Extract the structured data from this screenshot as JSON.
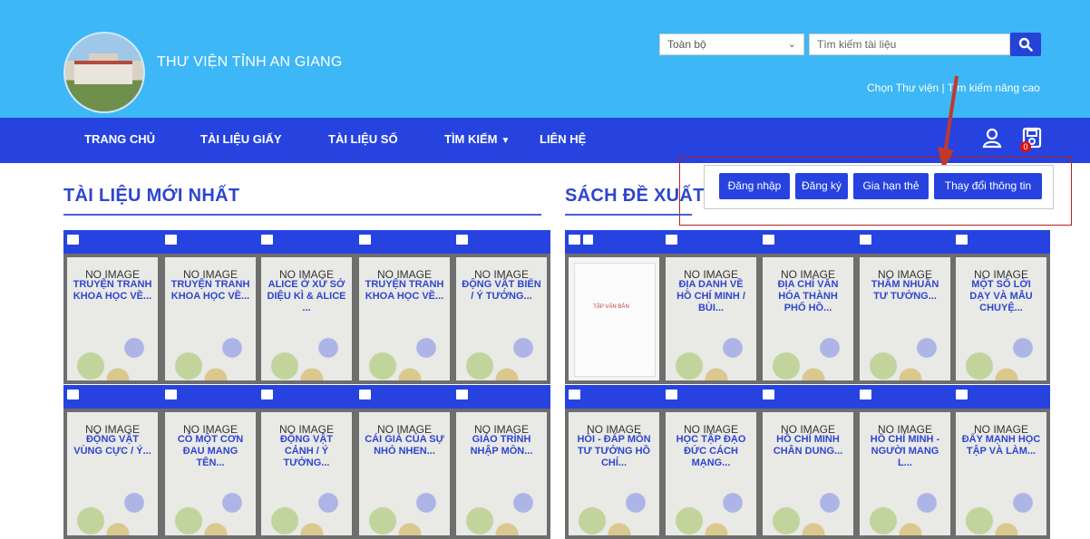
{
  "header": {
    "brand": "THƯ VIỆN TỈNH AN GIANG",
    "scope_value": "Toàn bộ",
    "search_placeholder": "Tìm kiếm tài liệu",
    "links": "Chọn Thư viện | Tìm kiếm nâng cao"
  },
  "nav": {
    "items": [
      {
        "label": "TRANG CHỦ"
      },
      {
        "label": "TÀI LIỆU GIẤY"
      },
      {
        "label": "TÀI LIỆU SỐ"
      },
      {
        "label": "TÌM KIẾM"
      },
      {
        "label": "LIÊN HỆ"
      }
    ],
    "cart_count": "0"
  },
  "user_menu": [
    "Đăng nhập",
    "Đăng ký",
    "Gia hạn thẻ",
    "Thay đổi thông tin"
  ],
  "sections": {
    "latest": "TÀI LIỆU MỚI NHẤT",
    "suggested": "SÁCH ĐỀ XUẤT"
  },
  "no_image": "NO IMAGE",
  "latest_books": [
    "TRUYỆN TRANH KHOA HỌC VỀ...",
    "TRUYỆN TRANH KHOA HỌC VỀ...",
    "ALICE Ở XỨ SỞ DIỆU KÌ & ALICE ...",
    "TRUYỆN TRANH KHOA HỌC VỀ...",
    "ĐỘNG VẬT BIỂN / Ý TƯỞNG...",
    "ĐỘNG VẬT VÙNG CỰC / Ý...",
    "CÓ MỘT CƠN ĐAU MANG TÊN...",
    "ĐỘNG VẬT CẢNH / Ý TƯỞNG...",
    "CÁI GIÁ CỦA SỰ NHỎ NHEN...",
    "GIÁO TRÌNH NHẬP MÔN..."
  ],
  "suggested_books": [
    "",
    "ĐỊA DANH VỀ HỒ CHÍ MINH / BÙI...",
    "ĐỊA CHÍ VĂN HÓA THÀNH PHỐ HỒ...",
    "THẤM NHUẦN TƯ TƯỞNG...",
    "MỘT SỐ LỜI DẠY VÀ MẪU CHUYỆ...",
    "HỎI - ĐÁP MÔN TƯ TƯỞNG HỒ CHÍ...",
    "HỌC TẬP ĐẠO ĐỨC CÁCH MẠNG...",
    "HỒ CHÍ MINH CHÂN DUNG...",
    "HỒ CHÍ MINH - NGƯỜI MANG L...",
    "ĐẨY MẠNH HỌC TẬP VÀ LÀM..."
  ],
  "doc_cover_title": "TẬP VĂN BẢN"
}
